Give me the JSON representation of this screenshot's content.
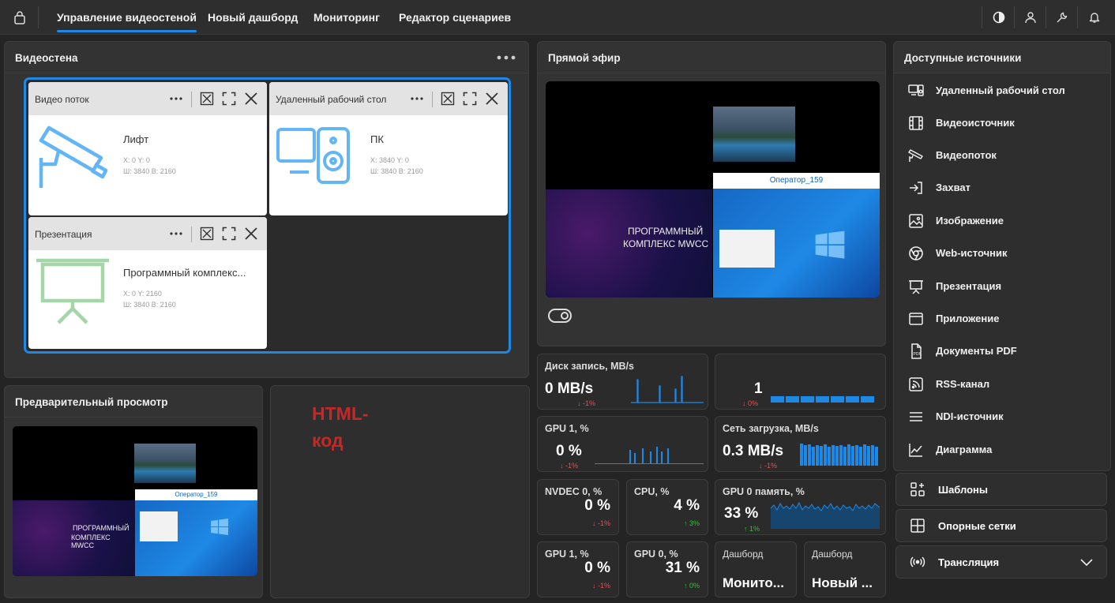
{
  "nav": {
    "tabs": [
      {
        "label": "Управление видеостеной"
      },
      {
        "label": "Новый дашборд"
      },
      {
        "label": "Мониторинг"
      },
      {
        "label": "Редактор сценариев"
      }
    ],
    "active_tab": 0
  },
  "videowall": {
    "title": "Видеостена",
    "cards": [
      {
        "type": "Видео поток",
        "name": "Лифт",
        "pos": "X: 0 Y: 0",
        "size": "Ш: 3840 В: 2160",
        "icon": "camera-icon",
        "color": "#64b5f6"
      },
      {
        "type": "Удаленный рабочий стол",
        "name": "ПК",
        "pos": "X: 3840 Y: 0",
        "size": "Ш: 3840 В: 2160",
        "icon": "desktop-speaker-icon",
        "color": "#64b5f6"
      },
      {
        "type": "Презентация",
        "name": "Программный комплекс...",
        "pos": "X: 0 Y: 2160",
        "size": "Ш: 3840 В: 2160",
        "icon": "presentation-board-icon",
        "color": "#a5d6a7"
      }
    ]
  },
  "live": {
    "title": "Прямой эфир",
    "operator_label": "Оператор_159",
    "slide_title_line1": "ПРОГРАММНЫЙ",
    "slide_title_line2": "КОМПЛЕКС MWCC"
  },
  "preview": {
    "title": "Предварительный просмотр",
    "operator_label": "Оператор_159"
  },
  "html_widget": {
    "text": "HTML-код",
    "color": "#c62828"
  },
  "metrics": [
    {
      "title": "Диск запись, MB/s",
      "value": "0 MB/s",
      "delta": "↓ -1%",
      "dir": "down"
    },
    {
      "title": "",
      "value": "1",
      "delta": "↓ 0%",
      "dir": "down"
    },
    {
      "title": "GPU 1, %",
      "value": "0 %",
      "delta": "↓ -1%",
      "dir": "down"
    },
    {
      "title": "Сеть загрузка, MB/s",
      "value": "0.3 MB/s",
      "delta": "↓ -1%",
      "dir": "down"
    },
    {
      "title": "NVDEC 0, %",
      "value": "0 %",
      "delta": "↓ -1%",
      "dir": "down"
    },
    {
      "title": "CPU, %",
      "value": "4 %",
      "delta": "↑ 3%",
      "dir": "up"
    },
    {
      "title": "GPU 0 память, %",
      "value": "33 %",
      "delta": "↑ 1%",
      "dir": "up"
    },
    {
      "title": "GPU 1, %",
      "value": "0 %",
      "delta": "↓ -1%",
      "dir": "down"
    },
    {
      "title": "GPU 0, %",
      "value": "31 %",
      "delta": "↑ 0%",
      "dir": "up"
    },
    {
      "title": "Дашборд",
      "value": "Монито...",
      "delta": "",
      "dir": ""
    },
    {
      "title": "Дашборд",
      "value": "Новый ...",
      "delta": "",
      "dir": ""
    }
  ],
  "sources": {
    "title": "Доступные источники",
    "items": [
      {
        "label": "Удаленный рабочий стол",
        "icon": "remote-desktop-icon"
      },
      {
        "label": "Видеоисточник",
        "icon": "film-icon"
      },
      {
        "label": "Видеопоток",
        "icon": "camera-icon"
      },
      {
        "label": "Захват",
        "icon": "capture-icon"
      },
      {
        "label": "Изображение",
        "icon": "image-icon"
      },
      {
        "label": "Web-источник",
        "icon": "browser-icon"
      },
      {
        "label": "Презентация",
        "icon": "presentation-icon"
      },
      {
        "label": "Приложение",
        "icon": "app-window-icon"
      },
      {
        "label": "Документы PDF",
        "icon": "pdf-icon"
      },
      {
        "label": "RSS-канал",
        "icon": "rss-icon"
      },
      {
        "label": "NDI-источник",
        "icon": "ndi-icon"
      },
      {
        "label": "Диаграмма",
        "icon": "chart-icon"
      }
    ],
    "templates_label": "Шаблоны",
    "grids_label": "Опорные сетки",
    "broadcast_label": "Трансляция"
  },
  "colors": {
    "accent": "#1e88e5",
    "bar": "#1e88e5",
    "down": "#e05353",
    "up": "#3dbb3d"
  }
}
